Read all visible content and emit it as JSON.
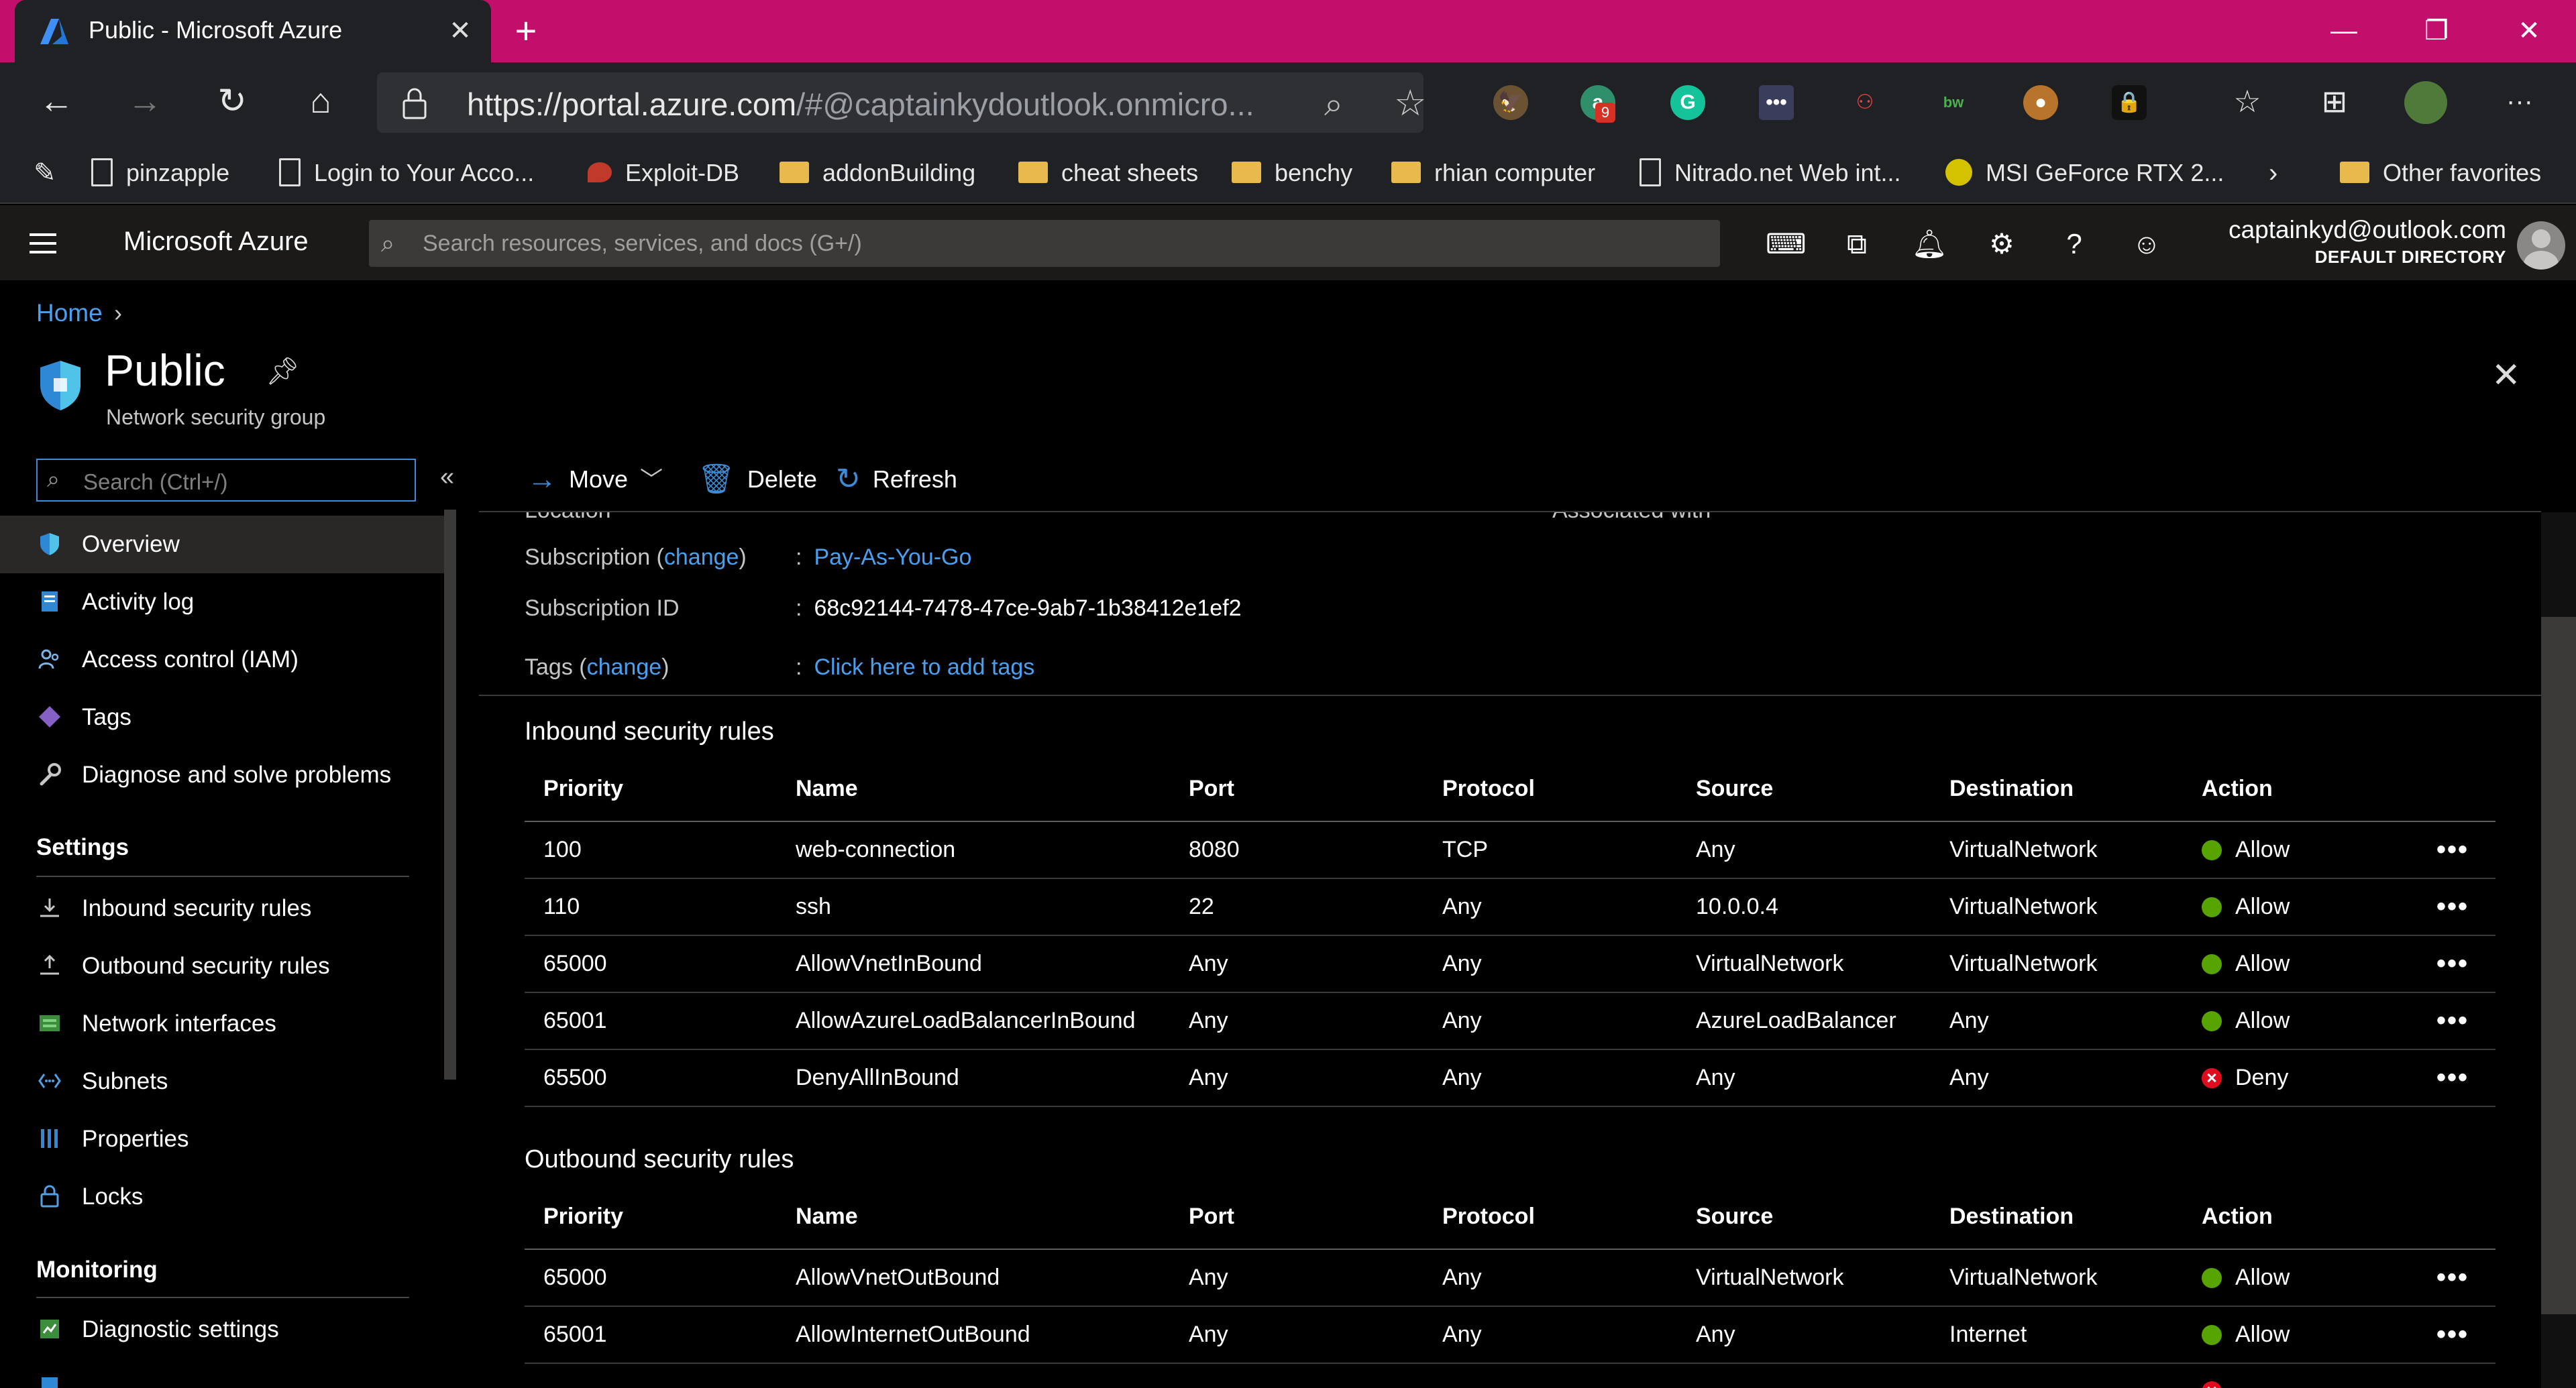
{
  "browser": {
    "tab_title": "Public - Microsoft Azure",
    "close_glyph": "✕",
    "new_tab_glyph": "+",
    "url_main": "https://portal.azure.com",
    "url_rest": "/#@captainkydoutlook.onmicro...",
    "nav_icons": {
      "back": "←",
      "forward": "→",
      "reload": "↻",
      "home": "⌂"
    },
    "extensions_badge": "9",
    "window_controls": {
      "minimize": "—",
      "restore": "❐",
      "close": "✕"
    },
    "bookmarks": [
      {
        "label": "pinzapple",
        "icon": "page-icon"
      },
      {
        "label": "Login to Your Acco...",
        "icon": "page-icon"
      },
      {
        "label": "Exploit-DB",
        "icon": "exploitdb-icon"
      },
      {
        "label": "addonBuilding",
        "icon": "folder-icon"
      },
      {
        "label": "cheat sheets",
        "icon": "folder-icon"
      },
      {
        "label": "benchy",
        "icon": "folder-icon"
      },
      {
        "label": "rhian computer",
        "icon": "folder-icon"
      },
      {
        "label": "Nitrado.net Web int...",
        "icon": "page-icon"
      },
      {
        "label": "MSI GeForce RTX 2...",
        "icon": "msi-icon"
      }
    ],
    "other_favorites": "Other favorites"
  },
  "azure": {
    "brand": "Microsoft Azure",
    "search_placeholder": "Search resources, services, and docs (G+/)",
    "account_email": "captainkyd@outlook.com",
    "account_directory": "DEFAULT DIRECTORY"
  },
  "page": {
    "breadcrumb_home": "Home",
    "title": "Public",
    "subtitle": "Network security group"
  },
  "menu": {
    "search_placeholder": "Search (Ctrl+/)",
    "items_top": [
      {
        "label": "Overview",
        "icon": "shield-icon"
      },
      {
        "label": "Activity log",
        "icon": "activity-log-icon"
      },
      {
        "label": "Access control (IAM)",
        "icon": "people-icon"
      },
      {
        "label": "Tags",
        "icon": "tag-icon"
      },
      {
        "label": "Diagnose and solve problems",
        "icon": "wrench-icon"
      }
    ],
    "settings_heading": "Settings",
    "items_settings": [
      {
        "label": "Inbound security rules",
        "icon": "inbound-icon"
      },
      {
        "label": "Outbound security rules",
        "icon": "outbound-icon"
      },
      {
        "label": "Network interfaces",
        "icon": "nic-icon"
      },
      {
        "label": "Subnets",
        "icon": "subnet-icon"
      },
      {
        "label": "Properties",
        "icon": "properties-icon"
      },
      {
        "label": "Locks",
        "icon": "lock-icon"
      }
    ],
    "monitoring_heading": "Monitoring",
    "items_monitoring": [
      {
        "label": "Diagnostic settings",
        "icon": "diagnostic-icon"
      }
    ]
  },
  "commands": {
    "move": "Move",
    "delete": "Delete",
    "refresh": "Refresh"
  },
  "essentials": {
    "subscription_label": "Subscription (",
    "subscription_change": "change",
    "subscription_close": ")",
    "subscription_value": "Pay-As-You-Go",
    "subscription_id_label": "Subscription ID",
    "subscription_id_value": "68c92144-7478-47ce-9ab7-1b38412e1ef2",
    "tags_label": "Tags (",
    "tags_change": "change",
    "tags_close": ")",
    "tags_value": "Click here to add tags",
    "colon": ":"
  },
  "columns": [
    "Priority",
    "Name",
    "Port",
    "Protocol",
    "Source",
    "Destination",
    "Action"
  ],
  "inbound": {
    "title": "Inbound security rules",
    "rows": [
      {
        "priority": "100",
        "name": "web-connection",
        "port": "8080",
        "protocol": "TCP",
        "source": "Any",
        "destination": "VirtualNetwork",
        "action": "Allow"
      },
      {
        "priority": "110",
        "name": "ssh",
        "port": "22",
        "protocol": "Any",
        "source": "10.0.0.4",
        "destination": "VirtualNetwork",
        "action": "Allow"
      },
      {
        "priority": "65000",
        "name": "AllowVnetInBound",
        "port": "Any",
        "protocol": "Any",
        "source": "VirtualNetwork",
        "destination": "VirtualNetwork",
        "action": "Allow"
      },
      {
        "priority": "65001",
        "name": "AllowAzureLoadBalancerInBound",
        "port": "Any",
        "protocol": "Any",
        "source": "AzureLoadBalancer",
        "destination": "Any",
        "action": "Allow"
      },
      {
        "priority": "65500",
        "name": "DenyAllInBound",
        "port": "Any",
        "protocol": "Any",
        "source": "Any",
        "destination": "Any",
        "action": "Deny"
      }
    ]
  },
  "outbound": {
    "title": "Outbound security rules",
    "rows": [
      {
        "priority": "65000",
        "name": "AllowVnetOutBound",
        "port": "Any",
        "protocol": "Any",
        "source": "VirtualNetwork",
        "destination": "VirtualNetwork",
        "action": "Allow"
      },
      {
        "priority": "65001",
        "name": "AllowInternetOutBound",
        "port": "Any",
        "protocol": "Any",
        "source": "Any",
        "destination": "Internet",
        "action": "Allow"
      }
    ]
  },
  "more_glyph": "•••",
  "colors": {
    "tabstrip": "#c20f6b",
    "link": "#4aa0f0",
    "allow": "#57a300",
    "deny": "#e00b1c"
  }
}
